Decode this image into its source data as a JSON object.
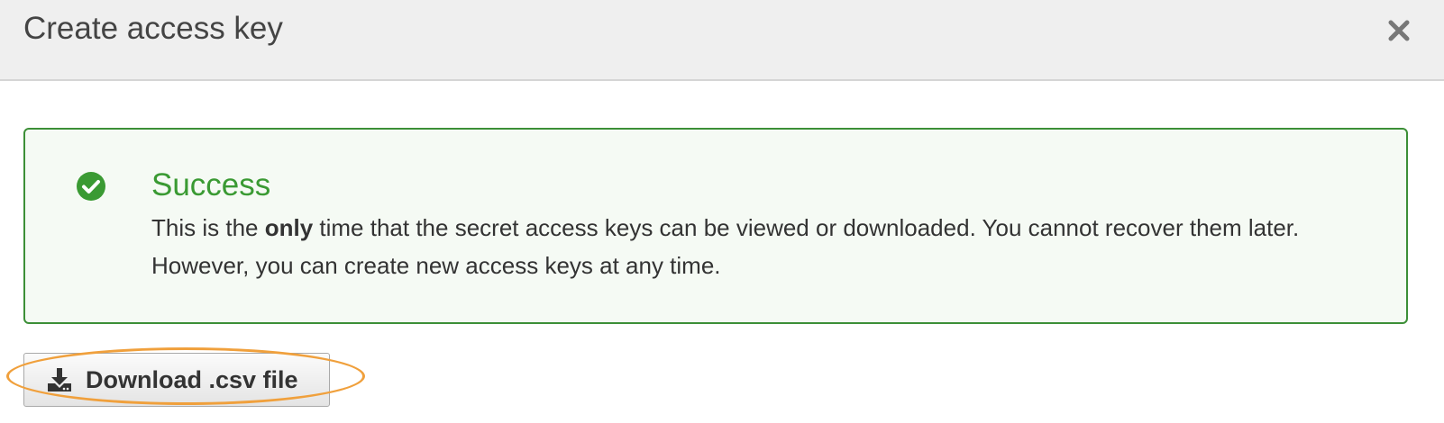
{
  "dialog": {
    "title": "Create access key",
    "close_label": "×"
  },
  "alert": {
    "heading": "Success",
    "body_prefix": "This is the ",
    "body_emphasis": "only",
    "body_suffix": " time that the secret access keys can be viewed or downloaded. You cannot recover them later. However, you can create new access keys at any time.",
    "icon": "check-circle-icon",
    "color": "#3a9a33"
  },
  "download_button": {
    "label": "Download .csv file",
    "icon": "download-icon"
  },
  "colors": {
    "success_border": "#3c8f37",
    "highlight": "#f0a03c",
    "header_bg": "#efefef"
  }
}
